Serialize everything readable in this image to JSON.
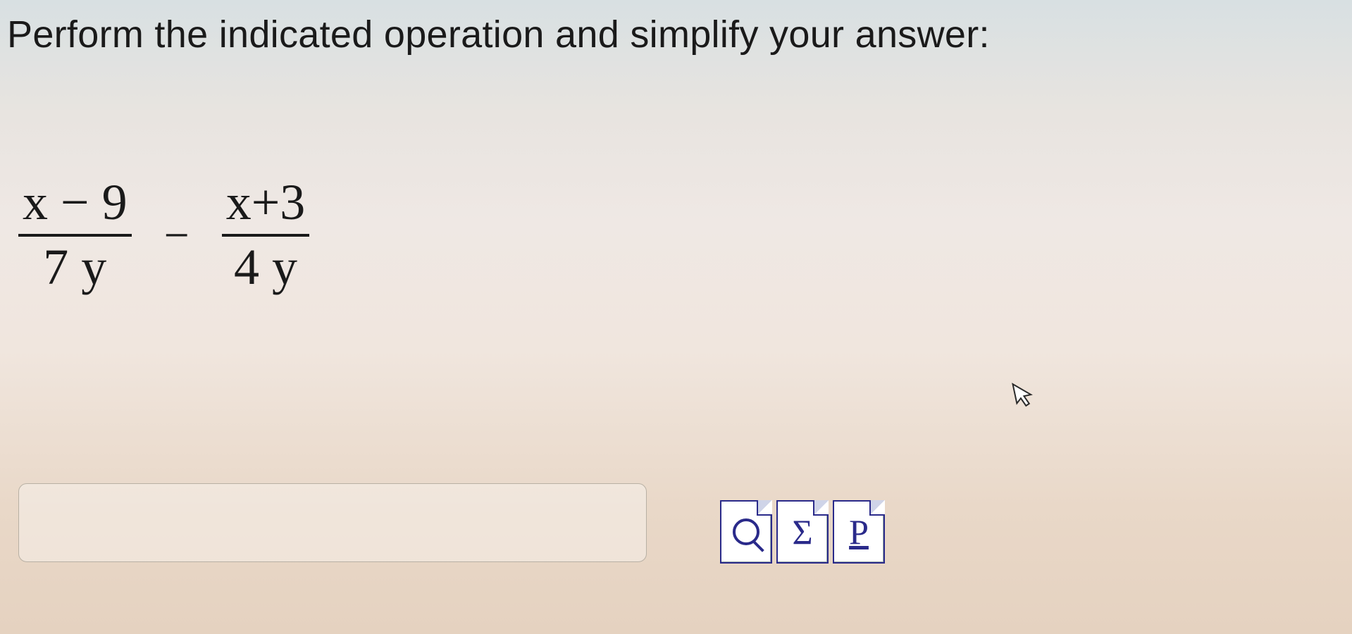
{
  "question": {
    "prompt": "Perform the indicated operation and simplify your answer:"
  },
  "equation": {
    "frac1": {
      "numerator": "x − 9",
      "denominator": "7 y"
    },
    "operator": "−",
    "frac2": {
      "numerator": "x+3",
      "denominator": "4 y"
    }
  },
  "answer": {
    "value": "",
    "placeholder": ""
  },
  "tools": {
    "preview": "Q",
    "sigma": "Σ",
    "help": "P"
  },
  "cursor": "↖"
}
